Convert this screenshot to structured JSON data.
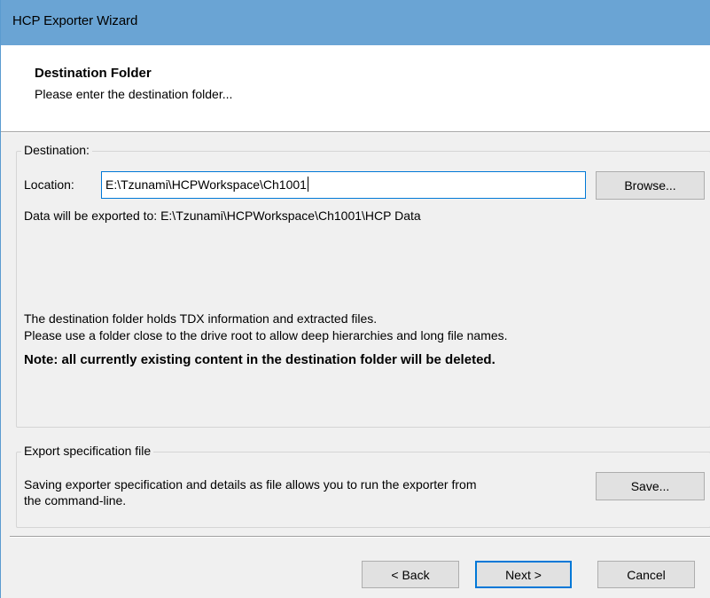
{
  "window": {
    "title": "HCP Exporter Wizard"
  },
  "header": {
    "title": "Destination Folder",
    "subtitle": "Please enter the destination folder..."
  },
  "destination_group": {
    "legend": "Destination:",
    "location_label": "Location:",
    "location_value": "E:\\Tzunami\\HCPWorkspace\\Ch1001",
    "browse_label": "Browse...",
    "export_path_text": "Data will be exported to: E:\\Tzunami\\HCPWorkspace\\Ch1001\\HCP Data",
    "info_line1": "The destination folder holds TDX information and extracted files.",
    "info_line2": "Please use a folder close to the drive root to allow deep hierarchies and long file names.",
    "note": "Note: all currently existing content in the destination folder will be deleted."
  },
  "spec_group": {
    "legend": "Export specification file",
    "description_line1": "Saving exporter specification and details as file allows you to run the exporter from",
    "description_line2": "the command-line.",
    "save_label": "Save..."
  },
  "footer": {
    "back_label": "< Back",
    "next_label": "Next >",
    "cancel_label": "Cancel"
  },
  "colors": {
    "titlebar": "#6aa4d4",
    "focus_border": "#0078d7",
    "panel_background": "#f0f0f0"
  }
}
